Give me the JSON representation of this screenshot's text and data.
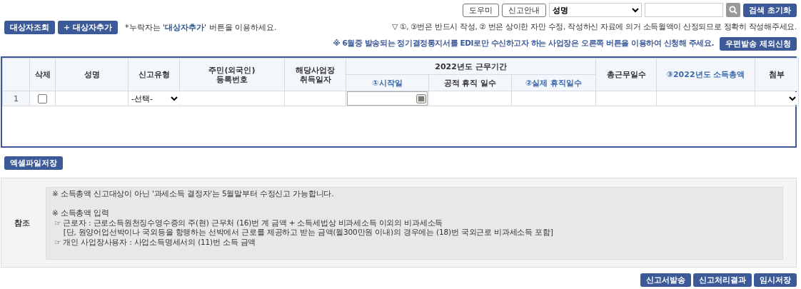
{
  "top_buttons": [
    "도우미",
    "신고안내"
  ],
  "search": {
    "field": "성명",
    "reset": "검색 초기화"
  },
  "actions": [
    "대상자조회",
    "+ 대상자추가"
  ],
  "note": "*누락자는 '**대상자추가**' 버튼을 이용하세요.",
  "guide": "▽ ①, ③번은 반드시 작성, ② 번은 상이한 자만 수정, 작성하신 자료에 의거 소득월액이 산정되므로 정확히 작성해주세요.",
  "edi_note": "※ 6월중 발송되는 정기결정통지서를 EDI로만 수신하고자 하는 사업장은 오른쪽 버튼을 이용하여 신청해 주세요.",
  "edi_button": "우편발송 제외신청",
  "table": {
    "group_header": "2022년도 근무기간",
    "columns": [
      {
        "label": "삭제",
        "color": "#333333"
      },
      {
        "label": "성명",
        "color": "#333333"
      },
      {
        "label": "신고유형",
        "color": "#333333"
      },
      {
        "label": "주민(외국인)\n등록번호",
        "color": "#333333"
      },
      {
        "label": "해당사업장\n취득일자",
        "color": "#333333"
      },
      {
        "label": "①시작일",
        "color": "#3d6aa8"
      },
      {
        "label": "공적 휴직 일수",
        "color": "#333333"
      },
      {
        "label": "②실제 휴직일수",
        "color": "#3d6aa8"
      },
      {
        "label": "총근무일수",
        "color": "#333333"
      },
      {
        "label": "③2022년도 소득총액",
        "color": "#3d6aa8"
      },
      {
        "label": "첨부",
        "color": "#333333"
      }
    ],
    "rows": [
      {
        "number": "1",
        "checked": false,
        "type": "-선택-"
      }
    ]
  },
  "excel_button": "엑셀파일저장",
  "reference": {
    "label": "참조",
    "paragraphs": [
      [
        "※ 소득총액 신고대상이 아닌 '과세소득 결정자'는 5월말부터 수정신고 가능합니다."
      ],
      [
        "※ 소득총액 입력",
        " ☞ 근로자 : 근로소득원천징수영수증의 주(현) 근무처 (16)번 계 금액 + 소득세법상 비과세소득 이외의 비과세소득",
        "     [단, 원양어업선박이나 국외등을 항행하는 선박에서 근로를 제공하고 받는 금액(월300만원 이내)의 경우에는 (18)번 국외근로 비과세소득 포함]",
        " ☞ 개인 사업장사용자 : 사업소득명세서의 (11)번 소득 금액"
      ]
    ]
  },
  "bottom_buttons": [
    "신고서발송",
    "신고처리결과",
    "임시저장"
  ]
}
